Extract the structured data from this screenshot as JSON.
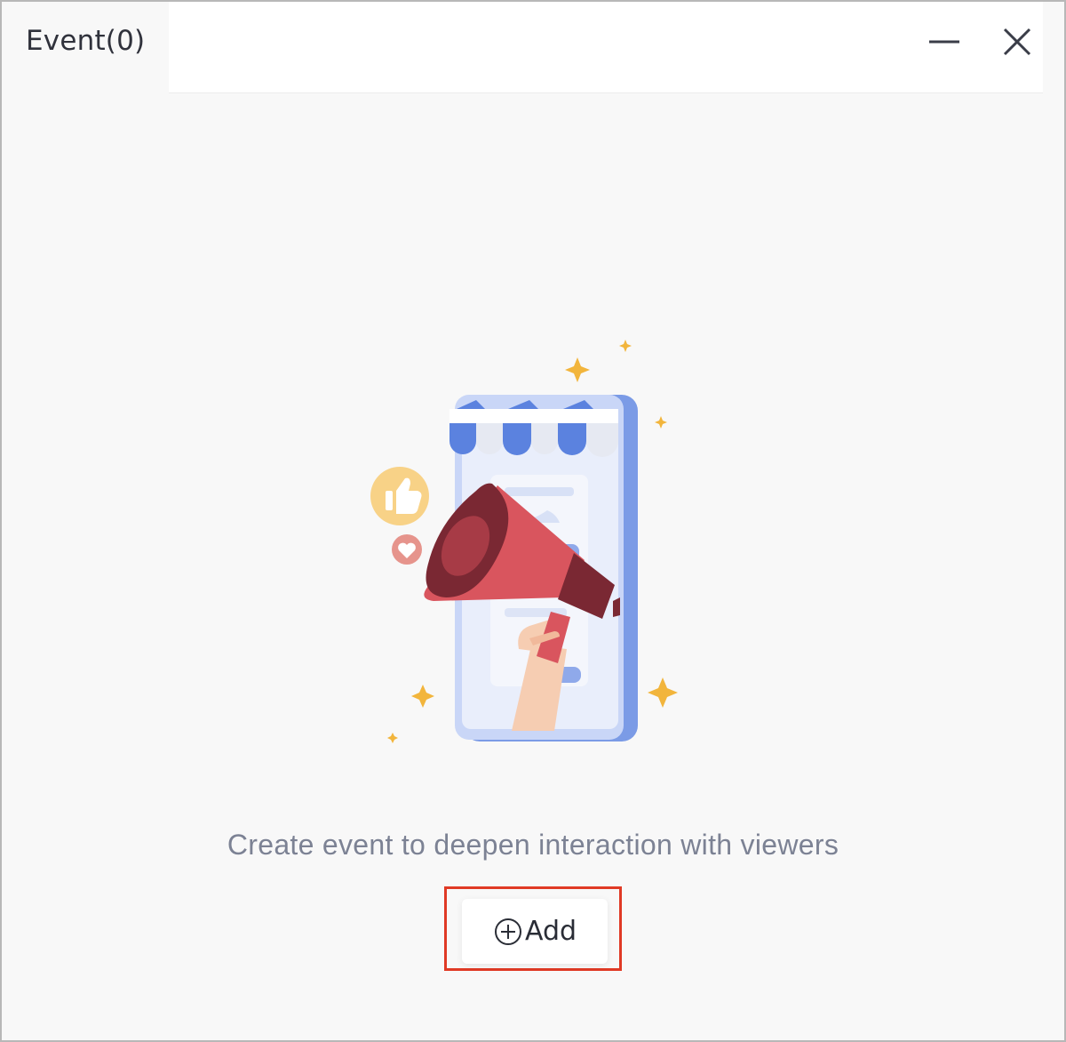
{
  "window": {
    "tab_title": "Event(0)",
    "controls": {
      "minimize_icon": "minimize-icon",
      "close_icon": "close-icon"
    }
  },
  "empty_state": {
    "message": "Create event to deepen interaction with viewers",
    "illustration": "megaphone-store-illustration"
  },
  "add_button": {
    "label": "Add",
    "icon": "plus-circle-icon"
  },
  "colors": {
    "highlight_border": "#e03a25",
    "background": "#f8f8f8",
    "text_primary": "#2a2d36",
    "text_muted": "#7c8294"
  }
}
